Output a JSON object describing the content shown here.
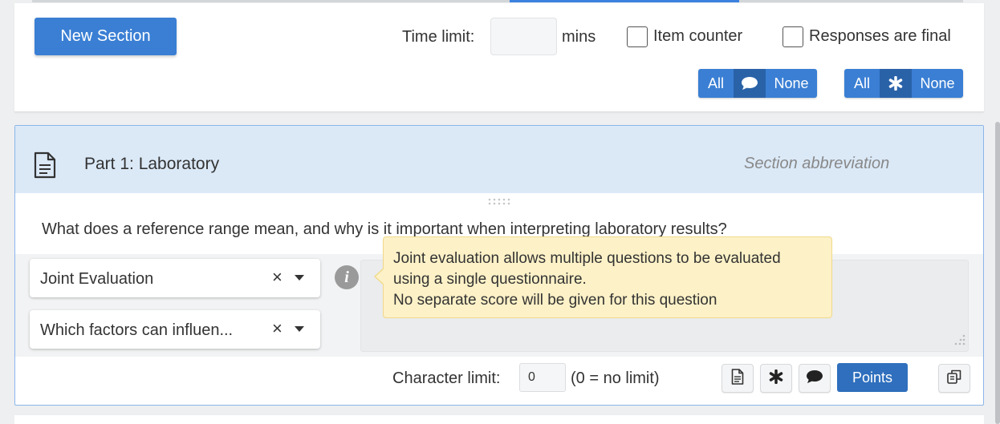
{
  "toolbar": {
    "new_section_label": "New Section",
    "time_limit_label": "Time limit:",
    "time_limit_value": "",
    "time_limit_unit": "mins",
    "item_counter_label": "Item counter",
    "item_counter_checked": false,
    "responses_final_label": "Responses are final",
    "responses_final_checked": false,
    "comment_toggle": {
      "all_label": "All",
      "none_label": "None",
      "icon": "speech-bubble-icon"
    },
    "required_toggle": {
      "all_label": "All",
      "none_label": "None",
      "icon": "asterisk-icon"
    }
  },
  "section": {
    "title": "Part 1: Laboratory",
    "abbreviation_placeholder": "Section abbreviation",
    "question_text": "What does a reference range mean, and why is it important when interpreting laboratory results?",
    "evaluation_select": {
      "value": "Joint Evaluation"
    },
    "linked_question_select": {
      "value": "Which factors can influen..."
    },
    "tooltip": {
      "line1": "Joint evaluation allows multiple questions to be evaluated",
      "line2": "using a single questionnaire.",
      "line3": "No separate score will be given for this question"
    },
    "character_limit_label": "Character limit:",
    "character_limit_value": "0",
    "character_limit_hint": "(0 = no limit)",
    "points_label": "Points"
  },
  "colors": {
    "primary": "#3a7fd4",
    "primary_dark": "#2a62a8",
    "section_header_bg": "#dbe9f7",
    "tooltip_bg": "#fdf1c7"
  }
}
